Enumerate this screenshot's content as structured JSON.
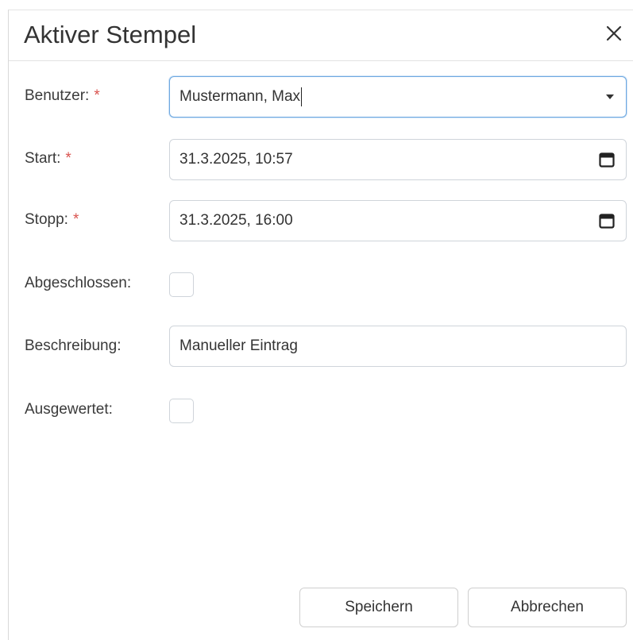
{
  "dialog": {
    "title": "Aktiver Stempel",
    "close_icon": "close-icon"
  },
  "form": {
    "user": {
      "label": "Benutzer:",
      "required_mark": "*",
      "value": "Mustermann, Max",
      "icon": "caret-down-icon"
    },
    "start": {
      "label": "Start:",
      "required_mark": "*",
      "value": "31.3.2025, 10:57",
      "icon": "calendar-icon"
    },
    "stop": {
      "label": "Stopp:",
      "required_mark": "*",
      "value": "31.3.2025, 16:00",
      "icon": "calendar-icon"
    },
    "completed": {
      "label": "Abgeschlossen:",
      "checked": false
    },
    "description": {
      "label": "Beschreibung:",
      "value": "Manueller Eintrag"
    },
    "evaluated": {
      "label": "Ausgewertet:",
      "checked": false
    }
  },
  "buttons": {
    "save_label": "Speichern",
    "cancel_label": "Abbrechen"
  },
  "colors": {
    "required": "#d9534f",
    "focus_border": "#6ea8e0",
    "border": "#cfd4da"
  }
}
